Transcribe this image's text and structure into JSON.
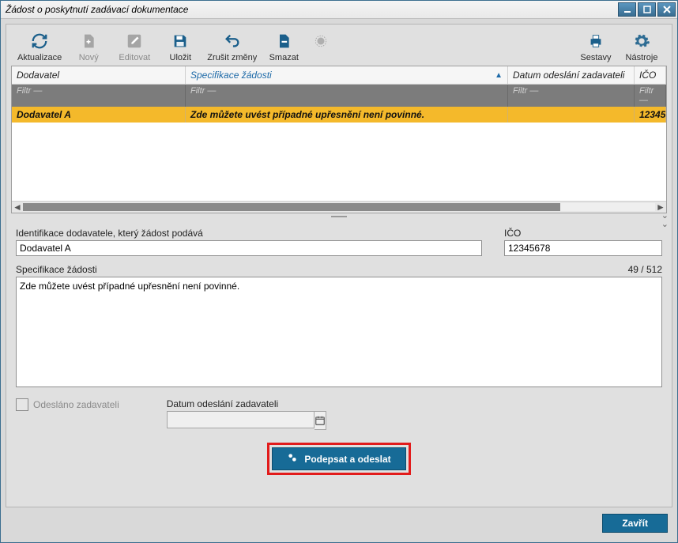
{
  "window": {
    "title": "Žádost o poskytnutí zadávací dokumentace"
  },
  "toolbar": {
    "aktualizace": "Aktualizace",
    "novy": "Nový",
    "editovat": "Editovat",
    "ulozit": "Uložit",
    "zrusit_zmeny": "Zrušit změny",
    "smazat": "Smazat",
    "sestavy": "Sestavy",
    "nastroje": "Nástroje"
  },
  "grid": {
    "headers": {
      "dodavatel": "Dodavatel",
      "specifikace": "Specifikace žádosti",
      "datum": "Datum odeslání zadavateli",
      "ico": "IČO"
    },
    "filter_placeholder": "Filtr —",
    "row": {
      "dodavatel": "Dodavatel A",
      "specifikace": "Zde můžete uvést případné upřesnění není povinné.",
      "datum": "",
      "ico": "12345"
    }
  },
  "form": {
    "id_label": "Identifikace dodavatele, který žádost podává",
    "id_value": "Dodavatel A",
    "ico_label": "IČO",
    "ico_value": "12345678",
    "spec_label": "Specifikace žádosti",
    "spec_counter": "49 / 512",
    "spec_value": "Zde můžete uvést případné upřesnění není povinné.",
    "odeslano_label": "Odesláno zadavateli",
    "datum_label": "Datum odeslání zadavateli",
    "datum_value": "",
    "submit_label": "Podepsat a odeslat"
  },
  "footer": {
    "close": "Zavřít"
  }
}
